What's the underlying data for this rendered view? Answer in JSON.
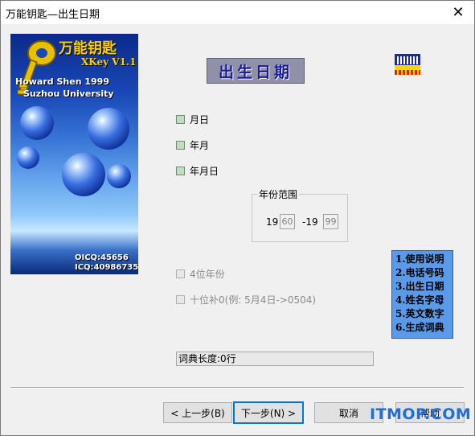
{
  "window": {
    "title": "万能钥匙—出生日期",
    "close_glyph": "✕"
  },
  "splash": {
    "brand": "万能钥匙",
    "version": "XKey V1.1",
    "author_line1": "Howard Shen 1999",
    "author_line2": "Suzhou University",
    "oicq": "OICQ:45656",
    "icq": "ICQ:40986735"
  },
  "banner": {
    "title": "出生日期"
  },
  "options": [
    {
      "label": "月日",
      "enabled": true
    },
    {
      "label": "年月",
      "enabled": true
    },
    {
      "label": "年月日",
      "enabled": true
    }
  ],
  "year_range": {
    "title": "年份范围",
    "from_prefix": "19",
    "from_value": "60",
    "to_prefix": "-19",
    "to_value": "99"
  },
  "extra_options": [
    {
      "label": "4位年份",
      "enabled": false
    },
    {
      "label": "十位补0(例: 5月4日->0504)",
      "enabled": false
    }
  ],
  "menu": [
    "1.使用说明",
    "2.电话号码",
    "3.出生日期",
    "4.姓名字母",
    "5.英文数字",
    "6.生成词典"
  ],
  "status": {
    "text": "词典长度:0行"
  },
  "buttons": {
    "back": "< 上一步(B)",
    "next": "下一步(N) >",
    "cancel": "取消",
    "help": "帮助"
  },
  "watermark": "ITMOP.COM",
  "colors": {
    "accent": "#0078d7",
    "menu_bg": "#5a9ae8",
    "banner_text": "#1a1aa0",
    "checkbox_fill": "#bfe0bf"
  }
}
